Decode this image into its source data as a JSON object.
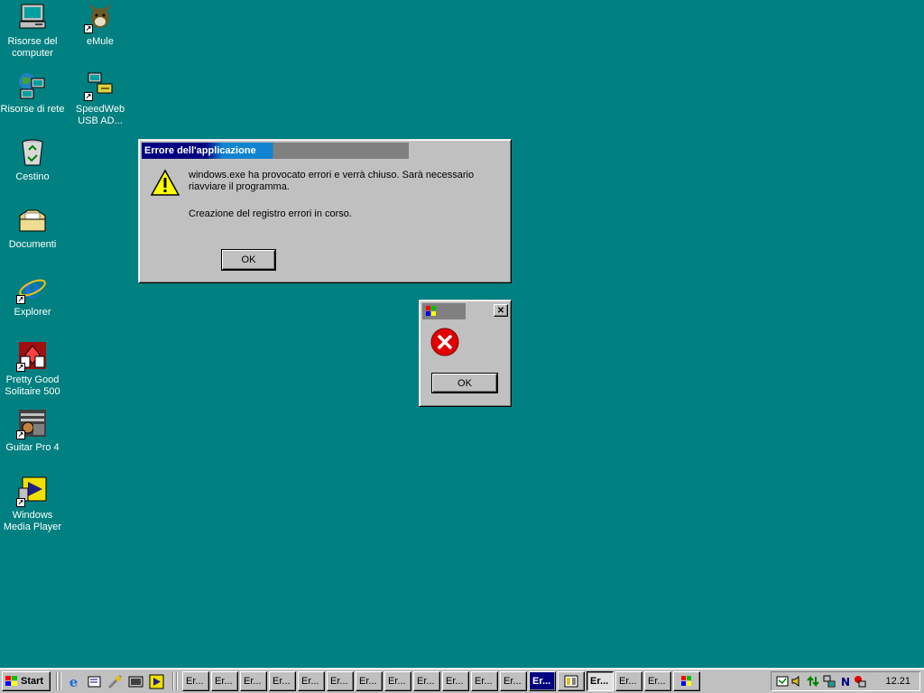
{
  "desktop": {
    "icons": [
      {
        "label": "Risorse del computer"
      },
      {
        "label": "eMule"
      },
      {
        "label": "Risorse di rete"
      },
      {
        "label": "SpeedWeb USB AD..."
      },
      {
        "label": "Cestino"
      },
      {
        "label": "Documenti"
      },
      {
        "label": "Explorer"
      },
      {
        "label": "Pretty Good Solitaire 500"
      },
      {
        "label": "Guitar Pro 4"
      },
      {
        "label": "Windows Media Player"
      }
    ]
  },
  "error_dialog": {
    "title": "Errore dell'applicazione",
    "message_line1": "windows.exe ha provocato errori e verrà chiuso. Sarà necessario",
    "message_line2": "riavviare il programma.",
    "message_line3": "Creazione del registro errori in corso.",
    "ok_label": "OK",
    "icon": "warning-icon"
  },
  "small_dialog": {
    "title": "",
    "ok_label": "OK",
    "icon": "error-icon",
    "close_glyph": "✕"
  },
  "taskbar": {
    "start_label": "Start",
    "buttons": [
      "Er...",
      "Er...",
      "Er...",
      "Er...",
      "Er...",
      "Er...",
      "Er...",
      "Er...",
      "Er...",
      "Er...",
      "Er...",
      "Er...",
      "Er...",
      "Er...",
      "Er...",
      "Er..."
    ],
    "clock": "12.21"
  },
  "colors": {
    "desktop": "#008080",
    "active_title_start": "#000080",
    "active_title_end": "#1084d0",
    "inactive_title": "#808080",
    "chrome": "#c0c0c0"
  }
}
